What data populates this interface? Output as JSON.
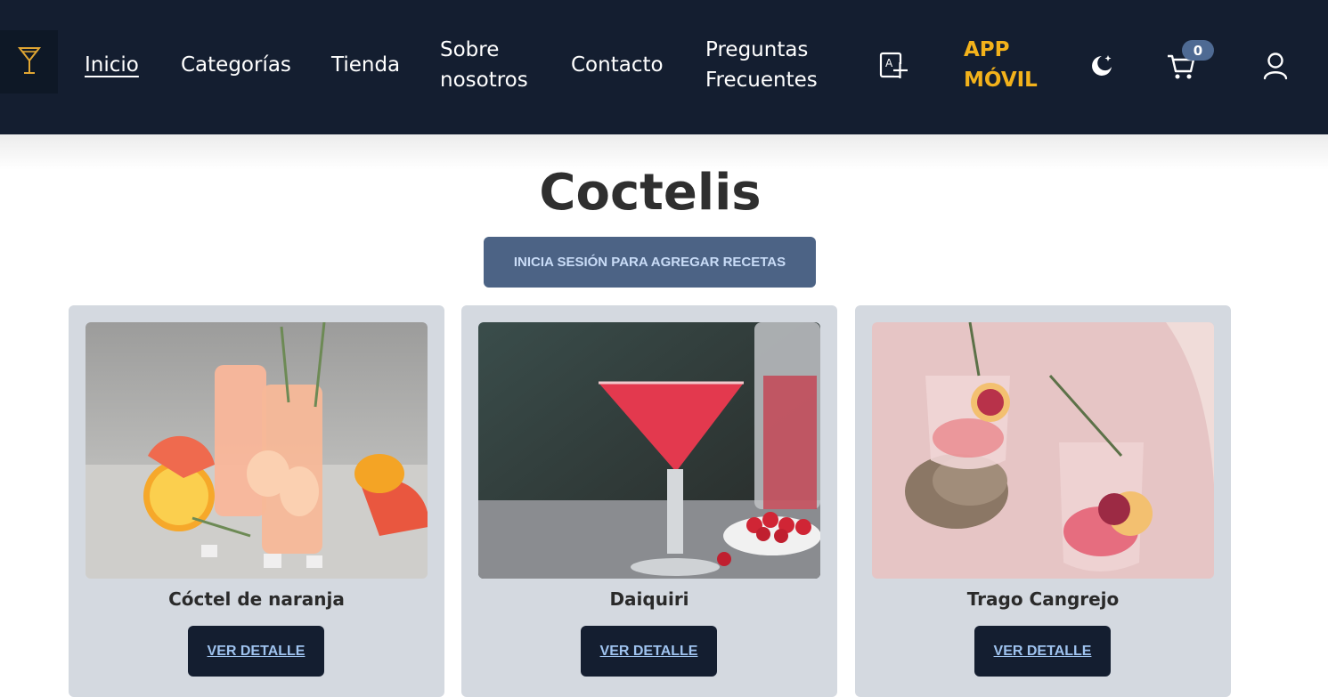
{
  "nav": {
    "links": [
      "Inicio",
      "Categorías",
      "Tienda",
      "Sobre",
      "nosotros",
      "Contacto",
      "Preguntas",
      "Frecuentes"
    ],
    "app_line1": "APP",
    "app_line2": "MÓVIL",
    "cart_count": "0",
    "icons": [
      "cocktail-glass-icon",
      "translate-icon",
      "moon-icon",
      "cart-icon",
      "user-icon"
    ]
  },
  "main": {
    "title": "Coctelis",
    "login_button": "INICIA SESIÓN PARA AGREGAR RECETAS"
  },
  "cards": [
    {
      "title": "Cóctel de naranja",
      "button": "VER DETALLE"
    },
    {
      "title": "Daiquiri",
      "button": "VER DETALLE"
    },
    {
      "title": "Trago Cangrejo",
      "button": "VER DETALLE"
    }
  ],
  "colors": {
    "navbar": "#141e30",
    "accent": "#f3b21b",
    "button": "#4c6385",
    "card": "#d4d9e0"
  }
}
